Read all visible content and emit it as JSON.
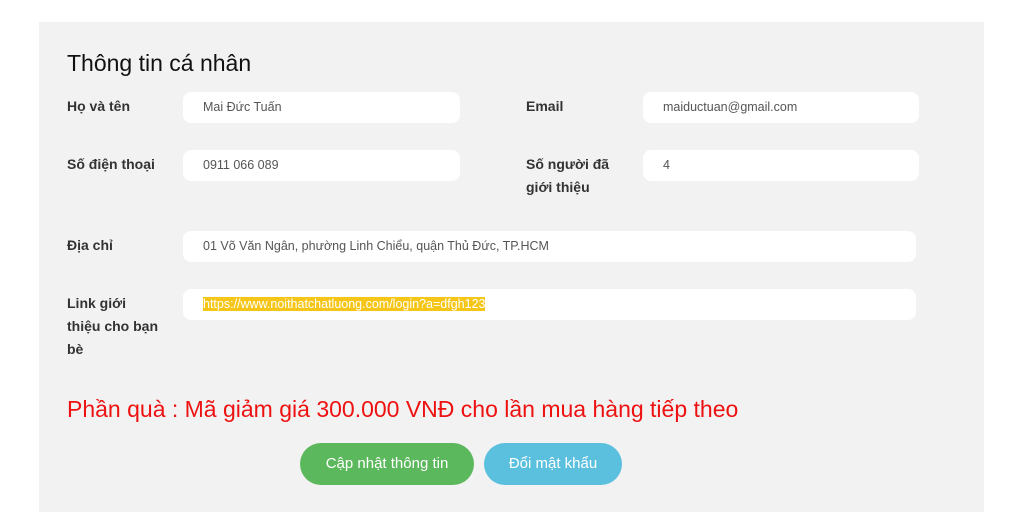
{
  "section_title": "Thông tin cá nhân",
  "fields": {
    "name": {
      "label": "Họ và tên",
      "value": "Mai Đức Tuấn"
    },
    "email": {
      "label": "Email",
      "value": "maiductuan@gmail.com"
    },
    "phone": {
      "label": "Số điện thoại",
      "value": "0911 066 089"
    },
    "referrals": {
      "label_line1": "Số người đã",
      "label_line2": "giới thiệu",
      "value": "4"
    },
    "address": {
      "label": "Địa chỉ",
      "value": "01 Võ Văn Ngân, phường Linh Chiểu, quận Thủ Đức, TP.HCM"
    },
    "referral_link": {
      "label_line1": "Link giới",
      "label_line2": "thiệu cho bạn",
      "label_line3": "bè",
      "value": "https://www.noithatchatluong.com/login?a=dfgh123"
    }
  },
  "gift_text": "Phần quà : Mã giảm giá 300.000 VNĐ cho lần mua hàng tiếp theo",
  "buttons": {
    "update_label": "Cập nhật thông tin",
    "change_password_label": "Đổi mật khẩu"
  },
  "colors": {
    "panel_bg": "#f2f2f2",
    "gift_text": "#ee1111",
    "update_button": "#5cb85c",
    "password_button": "#5bc0de",
    "link_highlight": "#f5c518"
  }
}
